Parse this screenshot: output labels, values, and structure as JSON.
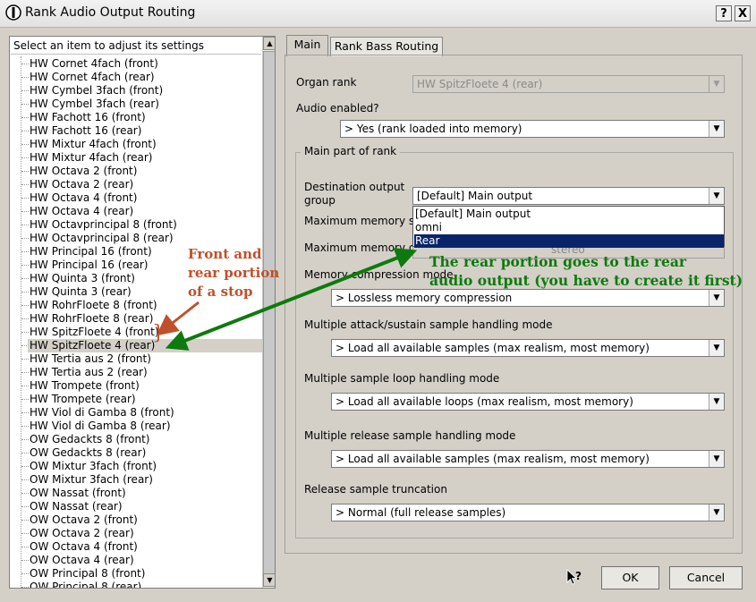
{
  "window": {
    "title": "Rank Audio Output Routing",
    "help_button": "?",
    "close_button": "X"
  },
  "list": {
    "header": "Select an item to adjust its settings",
    "items": [
      "HW Cornet 4fach (front)",
      "HW Cornet 4fach (rear)",
      "HW Cymbel 3fach (front)",
      "HW Cymbel 3fach (rear)",
      "HW Fachott 16 (front)",
      "HW Fachott 16 (rear)",
      "HW Mixtur 4fach (front)",
      "HW Mixtur 4fach (rear)",
      "HW Octava 2 (front)",
      "HW Octava 2 (rear)",
      "HW Octava 4 (front)",
      "HW Octava 4 (rear)",
      "HW Octavprincipal 8 (front)",
      "HW Octavprincipal 8 (rear)",
      "HW Principal 16 (front)",
      "HW Principal 16 (rear)",
      "HW Quinta 3 (front)",
      "HW Quinta 3 (rear)",
      "HW RohrFloete 8 (front)",
      "HW RohrFloete 8 (rear)",
      "HW SpitzFloete 4 (front)",
      "HW SpitzFloete 4 (rear)",
      "HW Tertia aus 2 (front)",
      "HW Tertia aus 2 (rear)",
      "HW Trompete (front)",
      "HW Trompete (rear)",
      "HW Viol di Gamba 8 (front)",
      "HW Viol di Gamba 8 (rear)",
      "OW Gedackts 8 (front)",
      "OW Gedackts 8 (rear)",
      "OW Mixtur 3fach (front)",
      "OW Mixtur 3fach (rear)",
      "OW Nassat (front)",
      "OW Nassat (rear)",
      "OW Octava 2 (front)",
      "OW Octava 2 (rear)",
      "OW Octava 4 (front)",
      "OW Octava 4 (rear)",
      "OW Principal 8 (front)",
      "OW Principal 8 (rear)"
    ],
    "selected_index": 21
  },
  "tabs": [
    "Main",
    "Rank Bass Routing"
  ],
  "form": {
    "organ_rank_label": "Organ rank",
    "organ_rank_value": "HW SpitzFloete 4 (rear)",
    "audio_enabled_label": "Audio enabled?",
    "audio_enabled_value": "> Yes (rank loaded into memory)",
    "group_title": "Main part of rank",
    "dest_label_line1": "Destination output",
    "dest_label_line2": "group",
    "dest_value": "[Default] Main output",
    "dest_options": [
      "[Default] Main output",
      "omni",
      "Rear"
    ],
    "dest_highlighted_index": 2,
    "max_mem_sample_label": "Maximum memory sam",
    "max_mem_channel_label": "Maximum memory cha",
    "max_mem_channel_value": "stereo",
    "mem_comp_label": "Memory compression mode",
    "mem_comp_value": "> Lossless memory compression",
    "attack_label": "Multiple attack/sustain sample handling mode",
    "attack_value": "> Load all available samples (max realism, most memory)",
    "loop_label": "Multiple sample loop handling mode",
    "loop_value": "> Load all available loops (max realism, most memory)",
    "release_label": "Multiple release sample handling mode",
    "release_value": "> Load all available samples (max realism, most memory)",
    "trunc_label": "Release sample truncation",
    "trunc_value": "> Normal (full release samples)"
  },
  "buttons": {
    "ok": "OK",
    "cancel": "Cancel"
  },
  "annotations": {
    "red_line1": "Front and",
    "red_line2": "rear portion",
    "red_line3": "of a stop",
    "brace": "}",
    "green_line1": "The rear portion goes to the rear",
    "green_line2": "audio output (you have to create it first)"
  },
  "colors": {
    "annotation_red": "#c0502a",
    "annotation_green": "#0e7a0e",
    "highlight": "#0a246a"
  },
  "icons": {
    "app": "organ-pipe-icon",
    "context_help": "pointer-question-icon"
  }
}
